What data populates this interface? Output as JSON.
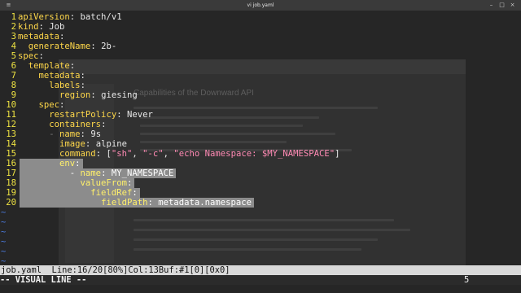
{
  "window": {
    "title": "vi job.yaml"
  },
  "editor": {
    "lines": [
      {
        "n": "1",
        "indent": "",
        "key": "apiVersion",
        "sep": ": ",
        "val": "batch/v1"
      },
      {
        "n": "2",
        "indent": "",
        "key": "kind",
        "sep": ": ",
        "val": "Job"
      },
      {
        "n": "3",
        "indent": "",
        "key": "metadata",
        "sep": ":",
        "val": ""
      },
      {
        "n": "4",
        "indent": "  ",
        "key": "generateName",
        "sep": ": ",
        "val": "2b-"
      },
      {
        "n": "5",
        "indent": "",
        "key": "spec",
        "sep": ":",
        "val": ""
      },
      {
        "n": "6",
        "indent": "  ",
        "key": "template",
        "sep": ":",
        "val": ""
      },
      {
        "n": "7",
        "indent": "    ",
        "key": "metadata",
        "sep": ":",
        "val": ""
      },
      {
        "n": "8",
        "indent": "      ",
        "key": "labels",
        "sep": ":",
        "val": ""
      },
      {
        "n": "9",
        "indent": "        ",
        "key": "region",
        "sep": ": ",
        "val": "giesing"
      },
      {
        "n": "10",
        "indent": "    ",
        "key": "spec",
        "sep": ":",
        "val": ""
      },
      {
        "n": "11",
        "indent": "      ",
        "key": "restartPolicy",
        "sep": ": ",
        "val": "Never"
      },
      {
        "n": "12",
        "indent": "      ",
        "key": "containers",
        "sep": ":",
        "val": ""
      },
      {
        "n": "13",
        "indent": "      - ",
        "key": "name",
        "sep": ": ",
        "val": "9s"
      },
      {
        "n": "14",
        "indent": "        ",
        "key": "image",
        "sep": ": ",
        "val": "alpine"
      },
      {
        "n": "15",
        "indent": "        ",
        "key": "command",
        "sep": ": ",
        "val": "",
        "list": [
          "\"sh\"",
          "\"-c\"",
          "\"echo Namespace: $MY_NAMESPACE\""
        ]
      },
      {
        "n": "16",
        "indent": "        ",
        "key": "env",
        "sep": ":",
        "val": "",
        "selected": true
      },
      {
        "n": "17",
        "indent": "          - ",
        "key": "name",
        "sep": ": ",
        "val": "MY_NAMESPACE",
        "selected": true
      },
      {
        "n": "18",
        "indent": "            ",
        "key": "valueFrom",
        "sep": ":",
        "val": "",
        "selected": true
      },
      {
        "n": "19",
        "indent": "              ",
        "key": "fieldRef",
        "sep": ":",
        "val": "",
        "selected": true
      },
      {
        "n": "20",
        "indent": "                ",
        "key": "fieldPath",
        "sep": ": ",
        "val": "metadata.namespace",
        "selected": true
      }
    ],
    "tilde": "~",
    "tilde_count": 6
  },
  "background_page": {
    "heading": "Capabilities of the Downward API"
  },
  "status": {
    "text": "job.yaml  Line:16/20[80%]Col:13Buf:#1[0][0x0]"
  },
  "mode": {
    "label": "-- VISUAL LINE --",
    "count": "5"
  },
  "colors": {
    "key": "#ffd84a",
    "string": "#ff8ab4",
    "line_number": "#f0e442",
    "selection": "#8c8c8c",
    "tilde": "#4a78d8"
  }
}
